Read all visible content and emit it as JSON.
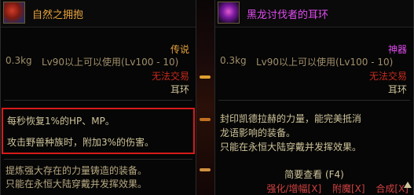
{
  "left_item": {
    "icon": "fist-equipment-icon",
    "name": "自然之拥抱",
    "rarity": "传说",
    "weight": "0.3kg",
    "level_req": "Lv90以上可以使用(Lv100 - 10)",
    "trade": "无法交易",
    "type": "耳环",
    "effects": [
      "每秒恢复1%的HP、MP。",
      "攻击野兽种族时，附加3%的伤害。"
    ],
    "description": [
      "提炼强大存在的力量铸造的装备。",
      "只能在永恒大陆穿戴并发挥效果。"
    ]
  },
  "right_item": {
    "icon": "dragon-earring-icon",
    "name": "黑龙讨伐者的耳环",
    "rarity": "神器",
    "weight": "0.3kg",
    "level_req": "Lv90以上可以使用(Lv100 - 10)",
    "trade": "无法交易",
    "type": "耳环",
    "description": [
      "封印凯德拉赫的力量，能完美抵消",
      "龙语影响的装备。",
      "只能在永恒大陆穿戴并发挥效果。"
    ],
    "simple_view": "简要查看 (F4)",
    "actions": [
      "强化/增幅[X]",
      "附魔[X]",
      "合成[X]"
    ]
  },
  "colors": {
    "legendary": "#e6a23c",
    "epic": "#e14cf0",
    "untradeable": "#c52a1e",
    "highlight_border": "#d81a1a"
  }
}
